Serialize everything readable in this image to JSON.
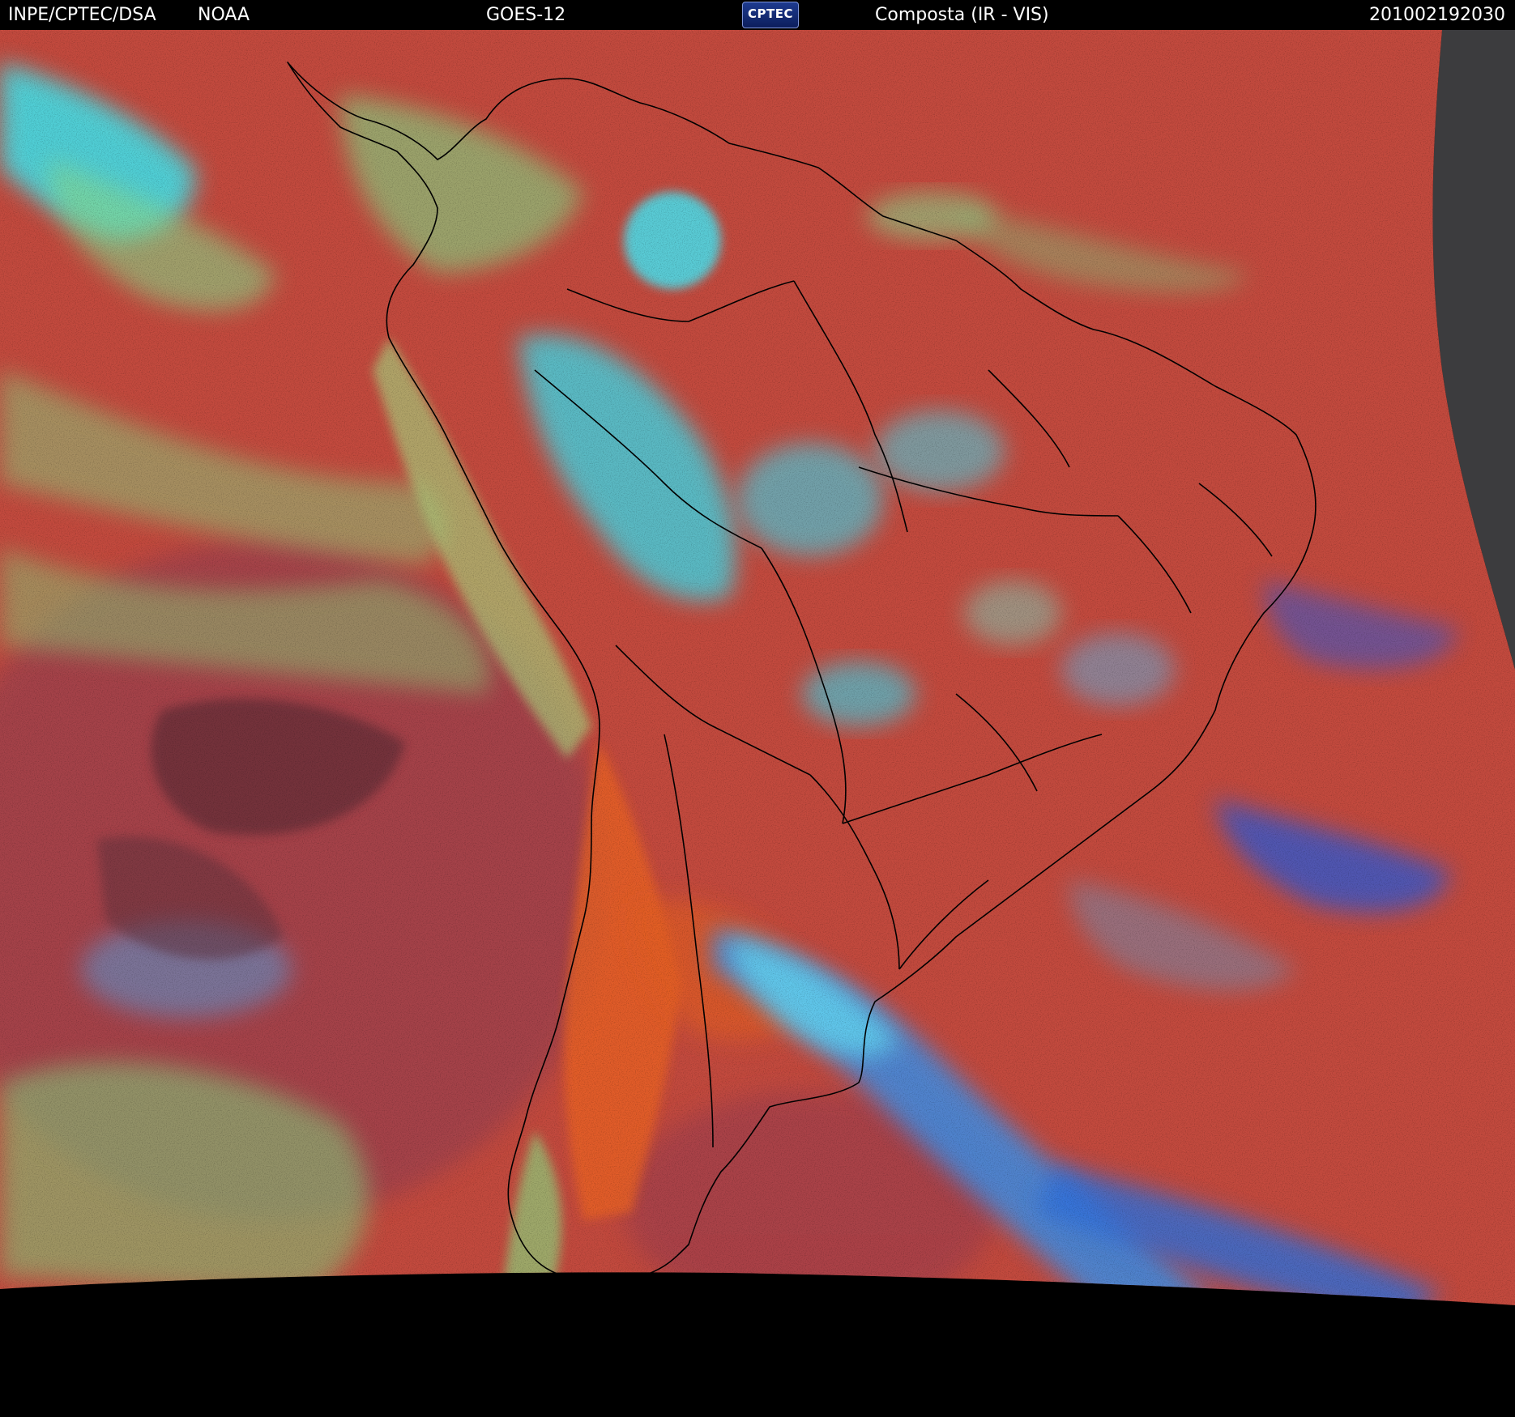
{
  "header": {
    "agency": "INPE/CPTEC/DSA",
    "source": "NOAA",
    "satellite": "GOES-12",
    "logo_text": "CPTEC",
    "product": "Composta (IR - VIS)",
    "timestamp": "201002192030"
  },
  "colors": {
    "background": "#000000",
    "clear_sky": "#c34a3e",
    "low_cloud": "#7fd18a",
    "high_cloud": "#37e0f2",
    "ice_cloud_blue": "#3a84e6",
    "land_dry": "#e0601e",
    "coastline": "#000000"
  }
}
